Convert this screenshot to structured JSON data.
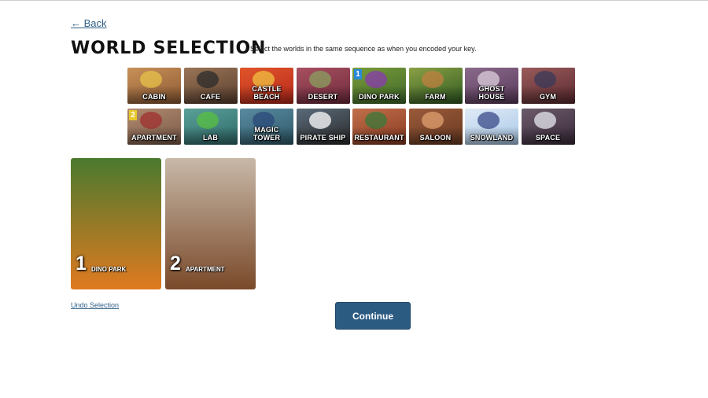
{
  "nav": {
    "back_label": "← Back"
  },
  "header": {
    "title": "WORLD SELECTION",
    "instructions": "Select the worlds in the same sequence as when you encoded your key."
  },
  "worlds": [
    {
      "label": "CABIN",
      "colors": [
        "#8d5a34",
        "#c89058"
      ],
      "accent": "#e7c24a"
    },
    {
      "label": "CAFE",
      "colors": [
        "#5a4030",
        "#9a7455"
      ],
      "accent": "#2b2b2b"
    },
    {
      "label": "CASTLE BEACH",
      "colors": [
        "#b8281c",
        "#e0552a"
      ],
      "accent": "#f0c040"
    },
    {
      "label": "DESERT",
      "colors": [
        "#6e2a3c",
        "#a85060"
      ],
      "accent": "#8aa060"
    },
    {
      "label": "DINO PARK",
      "colors": [
        "#3e6a2a",
        "#7a9a3a"
      ],
      "accent": "#8a3ab0",
      "badge": "1",
      "badge_color": "#2a8ad8"
    },
    {
      "label": "FARM",
      "colors": [
        "#2e5a22",
        "#8aa044"
      ],
      "accent": "#c08040"
    },
    {
      "label": "GHOST HOUSE",
      "colors": [
        "#5a3a5a",
        "#8a6a8a"
      ],
      "accent": "#ddd0dd"
    },
    {
      "label": "GYM",
      "colors": [
        "#5a2a30",
        "#9a5a5a"
      ],
      "accent": "#3a3a5a"
    },
    {
      "label": "APARTMENT",
      "colors": [
        "#7a5a48",
        "#b08a70"
      ],
      "accent": "#a03030",
      "badge": "2",
      "badge_color": "#e8c82a"
    },
    {
      "label": "LAB",
      "colors": [
        "#2e6a6a",
        "#5aa098"
      ],
      "accent": "#58c040"
    },
    {
      "label": "MAGIC TOWER",
      "colors": [
        "#2e5a6a",
        "#5a8aa0"
      ],
      "accent": "#2a4a7a"
    },
    {
      "label": "PIRATE SHIP",
      "colors": [
        "#2a2a2a",
        "#5a6a7a"
      ],
      "accent": "#ffffff"
    },
    {
      "label": "RESTAURANT",
      "colors": [
        "#8a3a22",
        "#c0704a"
      ],
      "accent": "#3a7a3a"
    },
    {
      "label": "SALOON",
      "colors": [
        "#6a3a22",
        "#9a5a3a"
      ],
      "accent": "#e0a070"
    },
    {
      "label": "SNOWLAND",
      "colors": [
        "#a8c8e8",
        "#e0eaf6"
      ],
      "accent": "#3a4a8a"
    },
    {
      "label": "SPACE",
      "colors": [
        "#3a2a3a",
        "#6a5a6a"
      ],
      "accent": "#e8e8f0"
    }
  ],
  "selection": [
    {
      "number": "1",
      "label": "DINO PARK",
      "colors": [
        "#4a7a2e",
        "#e07a20"
      ],
      "accent": "#8a3ab0"
    },
    {
      "number": "2",
      "label": "APARTMENT",
      "colors": [
        "#c8b8a8",
        "#7a4a2a"
      ],
      "accent": "#a03030"
    }
  ],
  "actions": {
    "undo_label": "Undo Selection",
    "continue_label": "Continue"
  }
}
